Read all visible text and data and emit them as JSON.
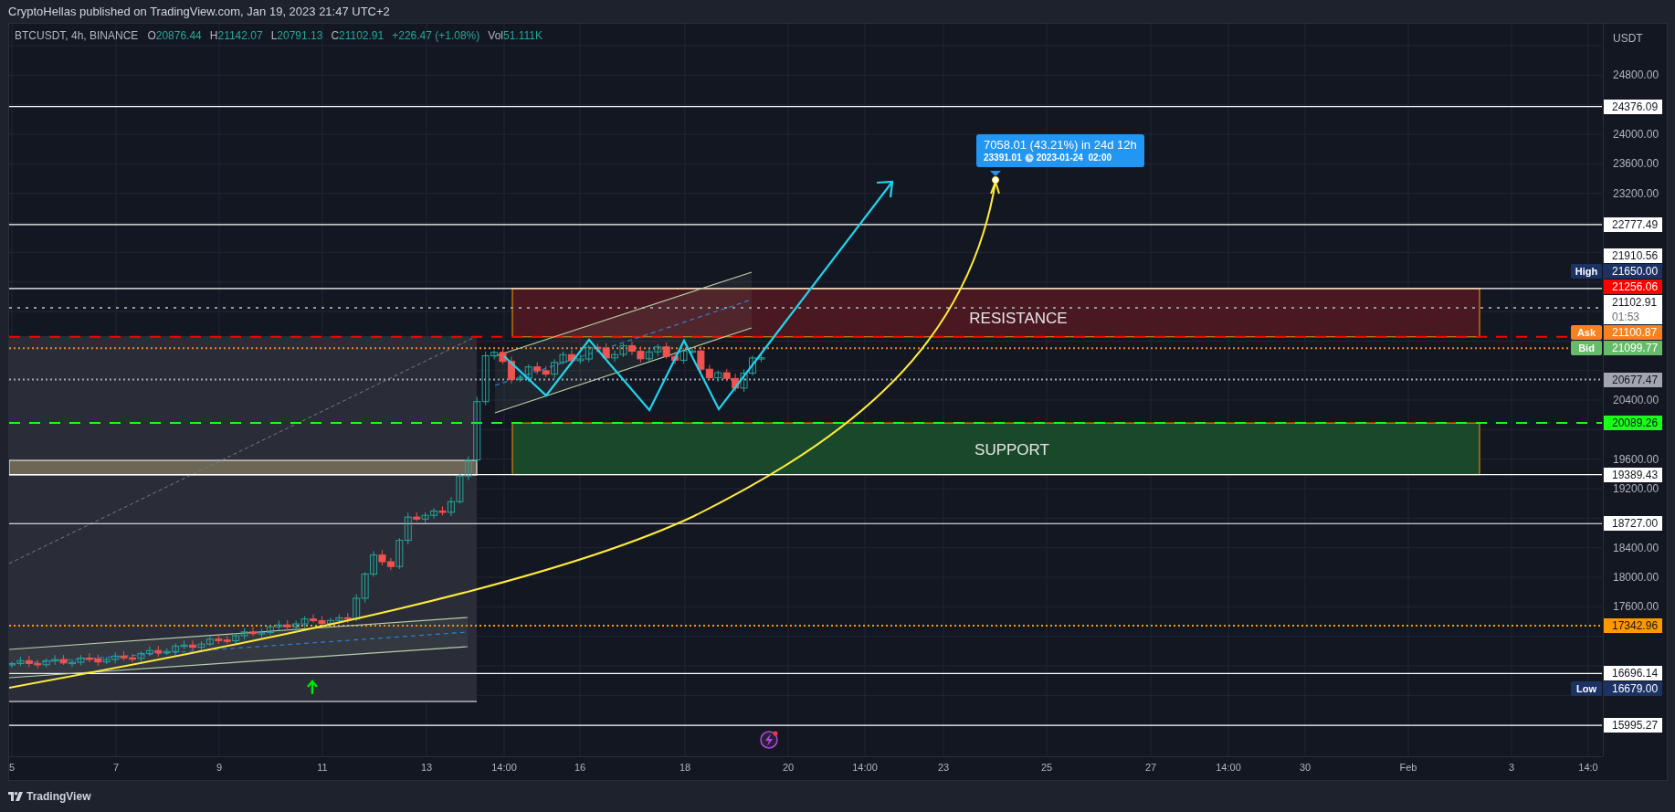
{
  "header": {
    "publisher_line": "CryptoHellas published on TradingView.com, Jan 19, 2023 21:47 UTC+2"
  },
  "legend": {
    "symbol": "BTCUSDT, 4h, BINANCE",
    "values": [
      {
        "label": "O",
        "value": "20876.44"
      },
      {
        "label": "H",
        "value": "21142.07"
      },
      {
        "label": "L",
        "value": "20791.13"
      },
      {
        "label": "C",
        "value": "21102.91"
      }
    ],
    "change": "+226.47 (+1.08%)",
    "volume": {
      "label": "Vol",
      "value": "51.111K"
    }
  },
  "price_axis": {
    "currency": "USDT",
    "ticks": [
      "24800.00",
      "24000.00",
      "23600.00",
      "23200.00",
      "20400.00",
      "19600.00",
      "19200.00",
      "18400.00",
      "18000.00",
      "17600.00"
    ]
  },
  "price_tags": [
    {
      "kind": "solid",
      "value": "24376.09",
      "color": "#ffffff"
    },
    {
      "kind": "solid",
      "value": "22777.49",
      "color": "#ffffff"
    },
    {
      "kind": "solid",
      "value": "21910.56",
      "color": "#ffffff"
    },
    {
      "kind": "greydotted",
      "name": "High",
      "value": "21650.00",
      "color": "#1c3264"
    },
    {
      "kind": "dashed",
      "value": "21256.06",
      "color": "#ff0000"
    },
    {
      "kind": "plain",
      "value": "21102.91",
      "countdown": "01:53",
      "color": "#ffffff"
    },
    {
      "kind": "dotted",
      "name": "Ask",
      "value": "21100.87",
      "color": "#f5821f"
    },
    {
      "kind": "plain",
      "name": "Bid",
      "value": "21099.77",
      "color": "#66bb6a"
    },
    {
      "kind": "dotted",
      "value": "20677.47",
      "color": "#a3a6af"
    },
    {
      "kind": "dashed",
      "value": "20089.26",
      "color": "#1aff1a"
    },
    {
      "kind": "solid",
      "value": "19389.43",
      "color": "#ffffff"
    },
    {
      "kind": "solid",
      "value": "18727.00",
      "color": "#ffffff"
    },
    {
      "kind": "dotted",
      "value": "17342.96",
      "color": "#ff9800"
    },
    {
      "kind": "solid",
      "value": "16696.14",
      "color": "#ffffff"
    },
    {
      "kind": "plain",
      "name": "Low",
      "value": "16679.00",
      "color": "#1c3264"
    },
    {
      "kind": "solid",
      "value": "15995.27",
      "color": "#ffffff"
    }
  ],
  "zones": [
    {
      "kind": "resistance",
      "label": "RESISTANCE"
    },
    {
      "kind": "support",
      "label": "SUPPORT"
    }
  ],
  "projection": {
    "change": "7058.01 (43.21%) in 24d 12h",
    "price": "23391.01",
    "time": "2023-01-24  02:00"
  },
  "time_axis": {
    "labels": [
      "5",
      "7",
      "9",
      "11",
      "13",
      "14:00",
      "16",
      "18",
      "20",
      "14:00",
      "23",
      "25",
      "27",
      "14:00",
      "30",
      "Feb",
      "3",
      "14:0"
    ]
  },
  "footer": {
    "brand": "TradingView"
  }
}
